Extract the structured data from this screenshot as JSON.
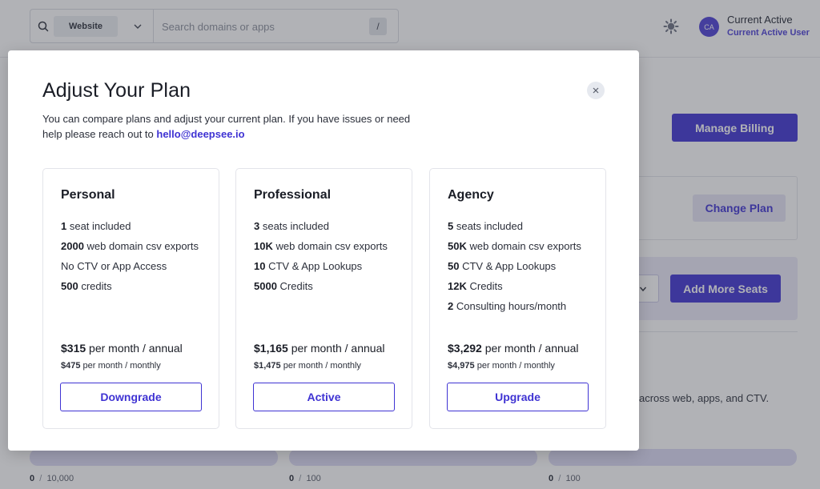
{
  "topbar": {
    "search_scope": "Website",
    "search_placeholder": "Search domains or apps",
    "search_shortcut": "/",
    "user_initials": "CA",
    "user_name": "Current Active",
    "user_subtitle": "Current Active User"
  },
  "background": {
    "manage_billing": "Manage Billing",
    "change_plan": "Change Plan",
    "add_more_seats": "Add More Seats",
    "description_fragment": "across web, apps, and CTV.",
    "usage": [
      {
        "used": "0",
        "sep": "/",
        "limit": "10,000"
      },
      {
        "used": "0",
        "sep": "/",
        "limit": "100"
      },
      {
        "used": "0",
        "sep": "/",
        "limit": "100"
      }
    ]
  },
  "modal": {
    "title": "Adjust Your Plan",
    "intro_text": "You can compare plans and adjust your current plan. If you have issues or need help please reach out to ",
    "contact_email": "hello@deepsee.io",
    "plans": [
      {
        "name": "Personal",
        "features": [
          {
            "bold": "1",
            "text": " seat included"
          },
          {
            "bold": "2000",
            "text": " web domain csv exports"
          },
          {
            "bold": "",
            "text": "No CTV or App Access"
          },
          {
            "bold": "500",
            "text": " credits"
          }
        ],
        "annual_price": "$315",
        "annual_label": " per month / annual",
        "monthly_price": "$475",
        "monthly_label": " per month / monthly",
        "button": "Downgrade"
      },
      {
        "name": "Professional",
        "features": [
          {
            "bold": "3",
            "text": " seats included"
          },
          {
            "bold": "10K",
            "text": " web domain csv exports"
          },
          {
            "bold": "10",
            "text": " CTV & App Lookups"
          },
          {
            "bold": "5000",
            "text": " Credits"
          }
        ],
        "annual_price": "$1,165",
        "annual_label": " per month / annual",
        "monthly_price": "$1,475",
        "monthly_label": " per month / monthly",
        "button": "Active"
      },
      {
        "name": "Agency",
        "features": [
          {
            "bold": "5",
            "text": " seats included"
          },
          {
            "bold": "50K",
            "text": " web domain csv exports"
          },
          {
            "bold": "50",
            "text": " CTV & App Lookups"
          },
          {
            "bold": "12K",
            "text": " Credits"
          },
          {
            "bold": "2",
            "text": " Consulting hours/month"
          }
        ],
        "annual_price": "$3,292",
        "annual_label": " per month / annual",
        "monthly_price": "$4,975",
        "monthly_label": " per month / monthly",
        "button": "Upgrade"
      }
    ]
  },
  "colors": {
    "accent": "#3f33d3",
    "overlay": "#3c3e48"
  }
}
